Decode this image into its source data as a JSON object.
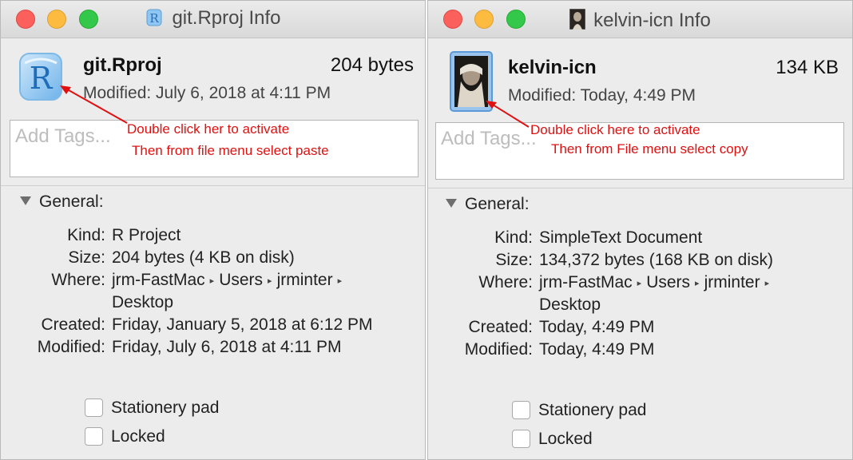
{
  "colors": {
    "annotation": "#e01010",
    "window_bg": "#ececec",
    "close": "#fc605c",
    "minimize": "#fdbc40",
    "zoom": "#34c84a"
  },
  "left": {
    "title": "git.Rproj Info",
    "title_icon": "rproj-file-icon",
    "file_name": "git.Rproj",
    "file_size": "204 bytes",
    "modified_line": "Modified: July 6, 2018 at 4:11 PM",
    "tags_placeholder": "Add Tags...",
    "annotation_line1": "Double click her to activate",
    "annotation_line2": "Then from file menu select paste",
    "general_heading": "General:",
    "kind_label": "Kind:",
    "kind_value": "R Project",
    "size_label": "Size:",
    "size_value": "204 bytes (4 KB on disk)",
    "where_label": "Where:",
    "where_path": [
      "jrm-FastMac",
      "Users",
      "jrminter"
    ],
    "where_line2": "Desktop",
    "created_label": "Created:",
    "created_value": "Friday, January 5, 2018 at 6:12 PM",
    "modified_label": "Modified:",
    "modified_value": "Friday, July 6, 2018 at 4:11 PM",
    "stationery_label": "Stationery pad",
    "locked_label": "Locked"
  },
  "right": {
    "title": "kelvin-icn Info",
    "title_icon": "portrait-thumbnail-icon",
    "file_name": "kelvin-icn",
    "file_size": "134 KB",
    "modified_line": "Modified: Today, 4:49 PM",
    "tags_placeholder": "Add Tags...",
    "annotation_line1": "Double click here to activate",
    "annotation_line2": "Then from File menu select copy",
    "general_heading": "General:",
    "kind_label": "Kind:",
    "kind_value": "SimpleText Document",
    "size_label": "Size:",
    "size_value": "134,372 bytes (168 KB on disk)",
    "where_label": "Where:",
    "where_path": [
      "jrm-FastMac",
      "Users",
      "jrminter"
    ],
    "where_line2": "Desktop",
    "created_label": "Created:",
    "created_value": "Today, 4:49 PM",
    "modified_label": "Modified:",
    "modified_value": "Today, 4:49 PM",
    "stationery_label": "Stationery pad",
    "locked_label": "Locked"
  }
}
